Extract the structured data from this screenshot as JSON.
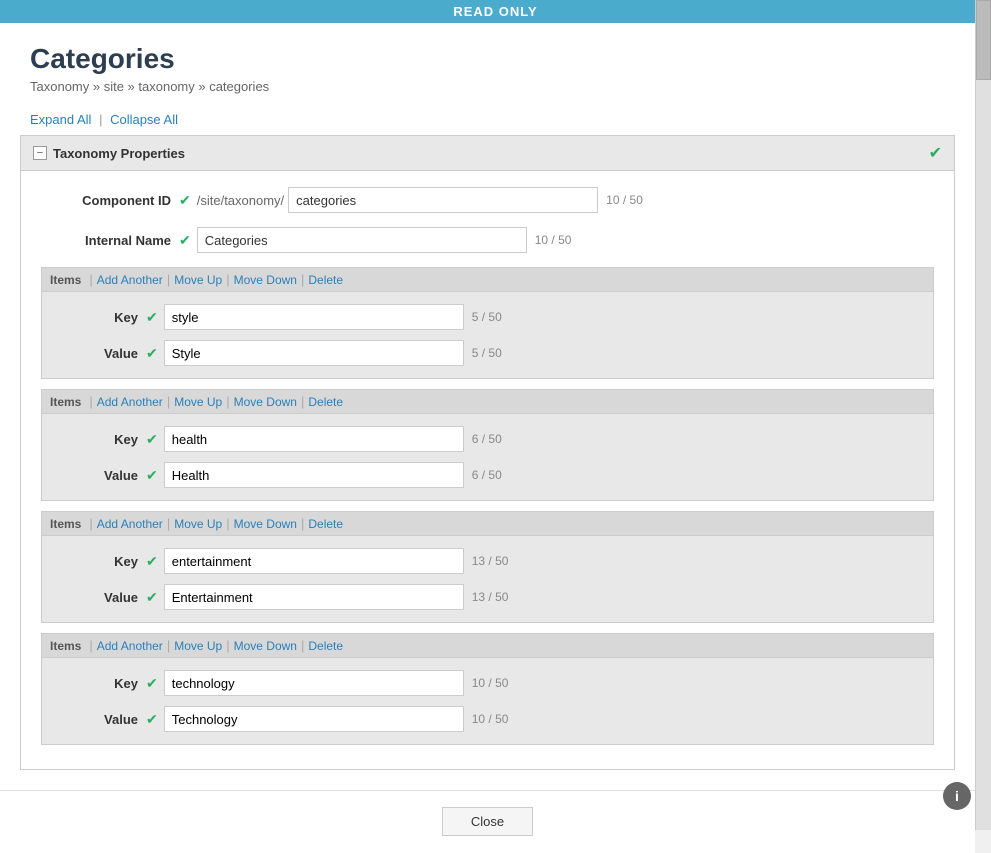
{
  "top_bar": {
    "label": "READ ONLY"
  },
  "header": {
    "title": "Categories",
    "breadcrumb": "Taxonomy » site » taxonomy » categories"
  },
  "toolbar": {
    "expand_all": "Expand All",
    "collapse_all": "Collapse All",
    "separator": "|"
  },
  "panel": {
    "title": "Taxonomy Properties",
    "collapse_symbol": "−",
    "fields": {
      "component_id": {
        "label": "Component ID",
        "prefix": "/site/taxonomy/",
        "value": "categories",
        "char_count": "10 / 50"
      },
      "internal_name": {
        "label": "Internal Name",
        "value": "Categories",
        "char_count": "10 / 50"
      }
    }
  },
  "items": [
    {
      "id": 1,
      "toolbar": {
        "label": "Items",
        "add_another": "Add Another",
        "move_up": "Move Up",
        "move_down": "Move Down",
        "delete": "Delete"
      },
      "key": {
        "label": "Key",
        "value": "style",
        "char_count": "5 / 50"
      },
      "value": {
        "label": "Value",
        "value": "Style",
        "char_count": "5 / 50"
      }
    },
    {
      "id": 2,
      "toolbar": {
        "label": "Items",
        "add_another": "Add Another",
        "move_up": "Move Up",
        "move_down": "Move Down",
        "delete": "Delete"
      },
      "key": {
        "label": "Key",
        "value": "health",
        "char_count": "6 / 50"
      },
      "value": {
        "label": "Value",
        "value": "Health",
        "char_count": "6 / 50"
      }
    },
    {
      "id": 3,
      "toolbar": {
        "label": "Items",
        "add_another": "Add Another",
        "move_up": "Move Up",
        "move_down": "Move Down",
        "delete": "Delete"
      },
      "key": {
        "label": "Key",
        "value": "entertainment",
        "char_count": "13 / 50"
      },
      "value": {
        "label": "Value",
        "value": "Entertainment",
        "char_count": "13 / 50"
      }
    },
    {
      "id": 4,
      "toolbar": {
        "label": "Items",
        "add_another": "Add Another",
        "move_up": "Move Up",
        "move_down": "Move Down",
        "delete": "Delete"
      },
      "key": {
        "label": "Key",
        "value": "technology",
        "char_count": "10 / 50"
      },
      "value": {
        "label": "Value",
        "value": "Technology",
        "char_count": "10 / 50"
      }
    }
  ],
  "footer": {
    "close_label": "Close"
  },
  "icons": {
    "check": "✔",
    "info": "i"
  }
}
